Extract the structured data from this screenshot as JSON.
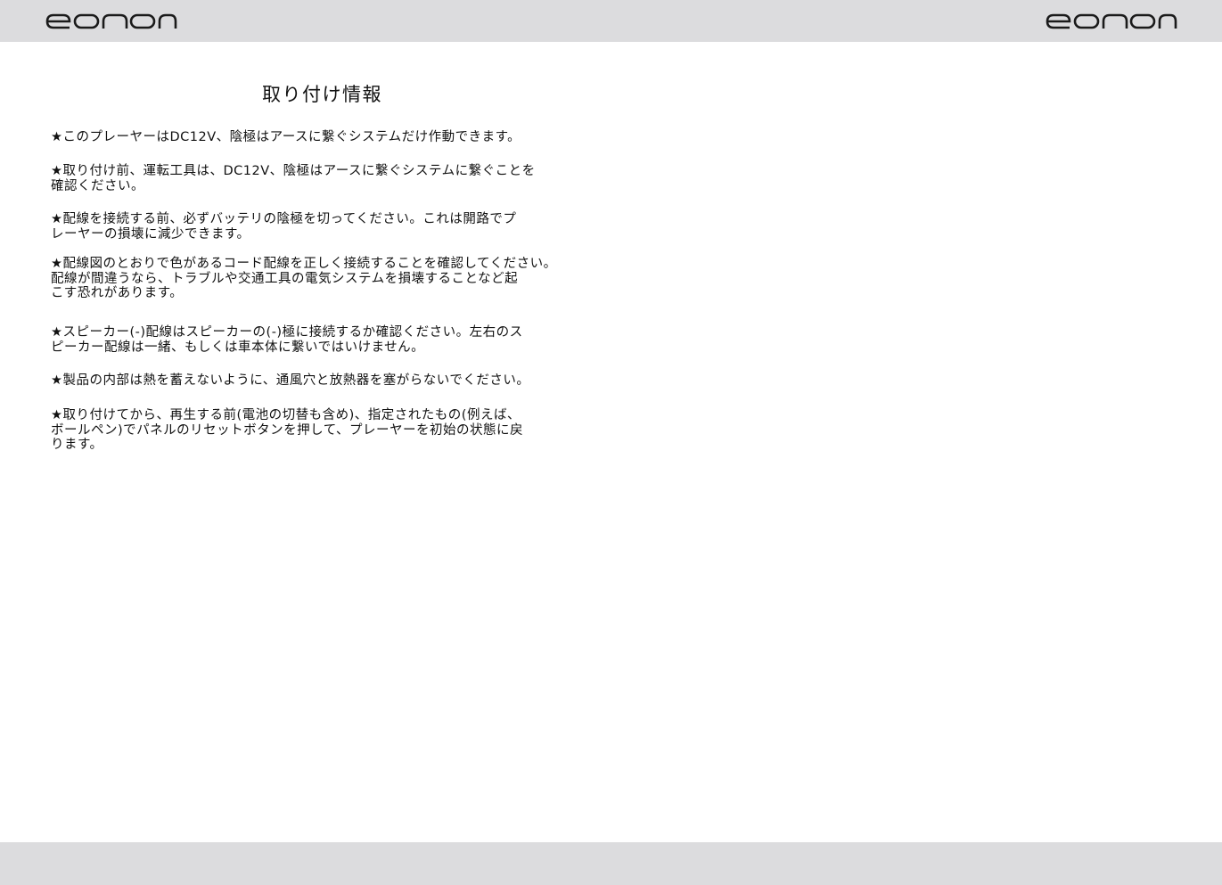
{
  "header": {
    "logo_left": "eonon",
    "logo_right": "eonon"
  },
  "document": {
    "title": "取り付け情報",
    "notes": [
      "★このプレーヤーはDC12V、陰極はアースに繋ぐシステムだけ作動できます。",
      "★取り付け前、運転工具は、DC12V、陰極はアースに繋ぐシステムに繋ぐことを\n確認ください。",
      "★配線を接続する前、必ずバッテリの陰極を切ってください。これは開路でプ\nレーヤーの損壊に減少できます。",
      "★配線図のとおりで色があるコード配線を正しく接続することを確認してください。\n配線が間違うなら、トラブルや交通工具の電気システムを損壊することなど起\nこす恐れがあります。",
      "★スピーカー(-)配線はスピーカーの(-)極に接続するか確認ください。左右のス\nピーカー配線は一緒、もしくは車本体に繋いではいけません。",
      "★製品の内部は熱を蓄えないように、通風穴と放熱器を塞がらないでください。",
      "★取り付けてから、再生する前(電池の切替も含め)、指定されたもの(例えば、\nボールペン)でパネルのリセットボタンを押して、プレーヤーを初始の状態に戻\nります。"
    ]
  },
  "colors": {
    "band": "#dcdcde",
    "text": "#111111",
    "logo": "#1a1a1a"
  }
}
